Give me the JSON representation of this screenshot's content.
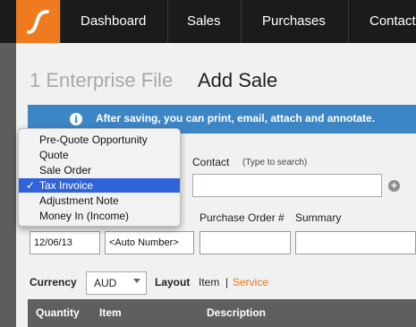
{
  "nav": {
    "items": [
      "Dashboard",
      "Sales",
      "Purchases",
      "Contact"
    ]
  },
  "page": {
    "file_name": "1 Enterprise File",
    "title": "Add Sale"
  },
  "info_bar": {
    "icon_glyph": "i",
    "text": "After saving, you can print, email, attach and annotate."
  },
  "sale_type_dropdown": {
    "options": [
      "Pre-Quote Opportunity",
      "Quote",
      "Sale Order",
      "Tax Invoice",
      "Adjustment Note",
      "Money In (Income)"
    ],
    "selected": "Tax Invoice",
    "check_glyph": "✓"
  },
  "contact": {
    "label": "Contact",
    "hint": "(Type to search)",
    "value": "",
    "add_glyph": "+"
  },
  "labels": {
    "purchase_order": "Purchase Order #",
    "summary": "Summary"
  },
  "fields": {
    "date": "12/06/13",
    "number": "<Auto Number>",
    "purchase_order": "",
    "summary": ""
  },
  "currency": {
    "label": "Currency",
    "value": "AUD"
  },
  "layout": {
    "label": "Layout",
    "item": "Item",
    "separator": "|",
    "service": "Service"
  },
  "table": {
    "headers": [
      "Quantity",
      "Item",
      "Description"
    ]
  },
  "colors": {
    "brand_orange": "#f07b1f",
    "info_blue": "#3d86c6",
    "selected_blue": "#2f63d9",
    "link_orange": "#e9731c"
  },
  "icons": [
    "logo-icon",
    "info-icon",
    "checkmark-icon",
    "add-contact-icon",
    "chevron-down-icon"
  ]
}
